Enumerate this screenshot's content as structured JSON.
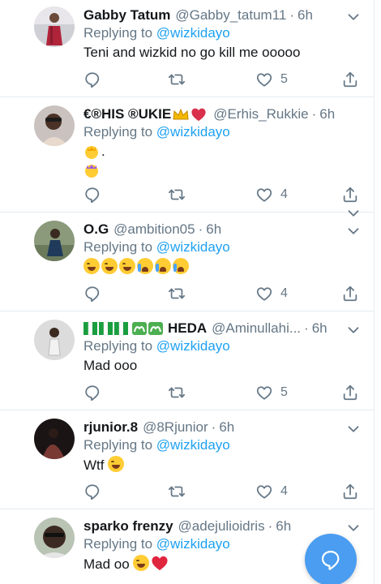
{
  "reply_prefix": "Replying to",
  "tweets": [
    {
      "name": "Gabby Tatum",
      "handle": "@Gabby_tatum11",
      "time": "6h",
      "reply_to": "@wizkidayo",
      "text": "Teni and wizkid no go kill me ooooo",
      "likes": "5"
    },
    {
      "name": "€®HIS ®UKIE",
      "handle": "@Erhis_Rukkie",
      "time": "6h",
      "reply_to": "@wizkidayo",
      "text": ".",
      "likes": "4"
    },
    {
      "name": "O.G",
      "handle": "@ambition05",
      "time": "6h",
      "reply_to": "@wizkidayo",
      "text": "",
      "likes": "4"
    },
    {
      "name": "HEDA",
      "handle": "@Aminullahi...",
      "time": "6h",
      "reply_to": "@wizkidayo",
      "text": "Mad ooo",
      "likes": "5"
    },
    {
      "name": "rjunior.8",
      "handle": "@8Rjunior",
      "time": "6h",
      "reply_to": "@wizkidayo",
      "text": "Wtf",
      "likes": "4"
    },
    {
      "name": "sparko frenzy",
      "handle": "@adejulioidris",
      "time": "6h",
      "reply_to": "@wizkidayo",
      "text": "Mad oo",
      "likes": ""
    }
  ],
  "icons": {
    "reply": "reply-icon",
    "retweet": "retweet-icon",
    "like": "heart-icon",
    "share": "share-icon",
    "more": "chevron-down-icon",
    "compose": "compose-reply-icon"
  },
  "colors": {
    "link": "#1da1f2",
    "muted": "#657786",
    "fab": "#4a9df0"
  }
}
